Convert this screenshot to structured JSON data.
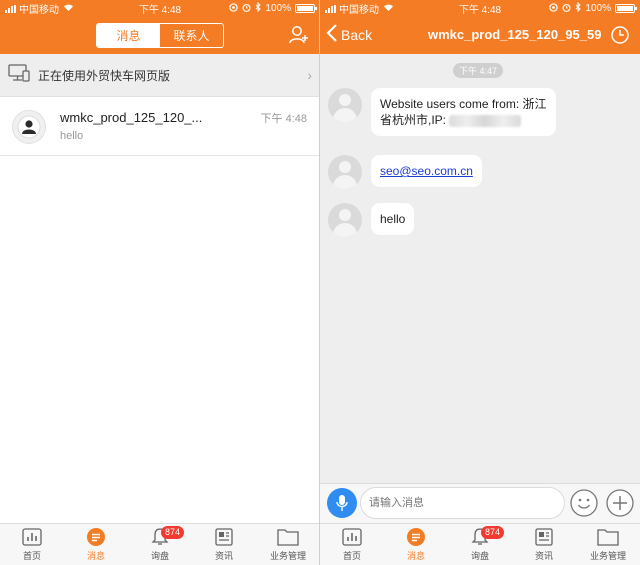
{
  "status_bar": {
    "carrier": "中国移动",
    "time": "下午 4:48",
    "battery": "100%",
    "battery_level": 1.0
  },
  "left_screen": {
    "segment": {
      "messages_label": "消息",
      "contacts_label": "联系人"
    },
    "web_banner": {
      "text": "正在使用外贸快车网页版"
    },
    "conversation": {
      "name": "wmkc_prod_125_120_...",
      "preview": "hello",
      "time": "下午 4:48"
    }
  },
  "right_screen": {
    "back_label": "Back",
    "title": "wmkc_prod_125_120_95_59",
    "time_chip": "下午 4:47",
    "messages": [
      {
        "line1": "Website users come from: 浙江",
        "line2": "省杭州市,IP:"
      },
      {
        "link": "seo@seo.com.cn"
      },
      {
        "text": "hello"
      }
    ],
    "input_placeholder": "请输入消息"
  },
  "tab_bar": {
    "items": [
      {
        "label": "首页",
        "icon": "chart-icon"
      },
      {
        "label": "消息",
        "icon": "chat-icon"
      },
      {
        "label": "询盘",
        "icon": "bell-icon",
        "badge": "874"
      },
      {
        "label": "资讯",
        "icon": "news-icon"
      },
      {
        "label": "业务管理",
        "icon": "folder-icon"
      }
    ]
  },
  "colors": {
    "brand_orange": "#f47c24",
    "badge_red": "#f23a2f",
    "link_blue": "#1a3ed4",
    "mic_blue": "#2f8cf0"
  }
}
